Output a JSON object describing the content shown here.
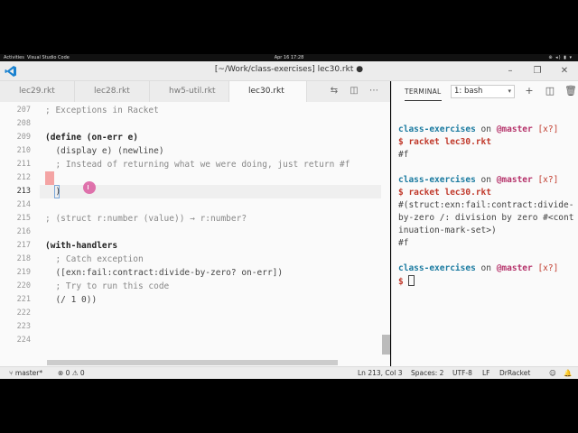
{
  "topbar": {
    "activities": "Activities",
    "app_name": "Visual Studio Code",
    "clock": "Apr 16  17:28",
    "system_icons": "⊕ ◂) ▮ ▾"
  },
  "window": {
    "title": "[~/Work/class-exercises] lec30.rkt ●"
  },
  "tabs": [
    {
      "label": "lec29.rkt"
    },
    {
      "label": "lec28.rkt"
    },
    {
      "label": "hw5-util.rkt"
    },
    {
      "label": "lec30.rkt"
    }
  ],
  "editor": {
    "line_numbers": [
      "207",
      "208",
      "209",
      "210",
      "211",
      "212",
      "213",
      "214",
      "215",
      "216",
      "217",
      "218",
      "219",
      "220",
      "221",
      "222",
      "223",
      "224"
    ],
    "lines": [
      "; Exceptions in Racket",
      "",
      "(define (on-err e)",
      "  (display e) (newline)",
      "  ; Instead of returning what we were doing, just return #f",
      "",
      "  )",
      "",
      "; (struct r:number (value)) → r:number?",
      "",
      "(with-handlers",
      "  ; Catch exception",
      "  ([exn:fail:contract:divide-by-zero? on-err])",
      "  ; Try to run this code",
      "  (/ 1 0))",
      "",
      "",
      ""
    ],
    "current_line": "213"
  },
  "panel": {
    "title": "TERMINAL",
    "selected_terminal": "1: bash"
  },
  "terminal": {
    "session1": {
      "dir": "class-exercises",
      "on": " on ",
      "branch": "@master",
      "dirty": " [x?]",
      "command": "$ racket lec30.rkt",
      "output": [
        "#f"
      ]
    },
    "session2": {
      "dir": "class-exercises",
      "on": " on ",
      "branch": "@master",
      "dirty": " [x?]",
      "command": "$ racket lec30.rkt",
      "output": [
        "#(struct:exn:fail:contract:divide-",
        "by-zero /: division by zero #<cont",
        "inuation-mark-set>)",
        "#f"
      ]
    },
    "session3": {
      "dir": "class-exercises",
      "on": " on ",
      "branch": "@master",
      "dirty": " [x?]",
      "prompt": "$ "
    }
  },
  "statusbar": {
    "branch": "master*",
    "problems": "⊗ 0 ⚠ 0",
    "position": "Ln 213, Col 3",
    "spaces": "Spaces: 2",
    "encoding": "UTF-8",
    "eol": "LF",
    "language": "DrRacket"
  },
  "colors": {
    "accent": "#1a7aa0",
    "branch": "#b5326a",
    "error": "#f4a4a4"
  }
}
